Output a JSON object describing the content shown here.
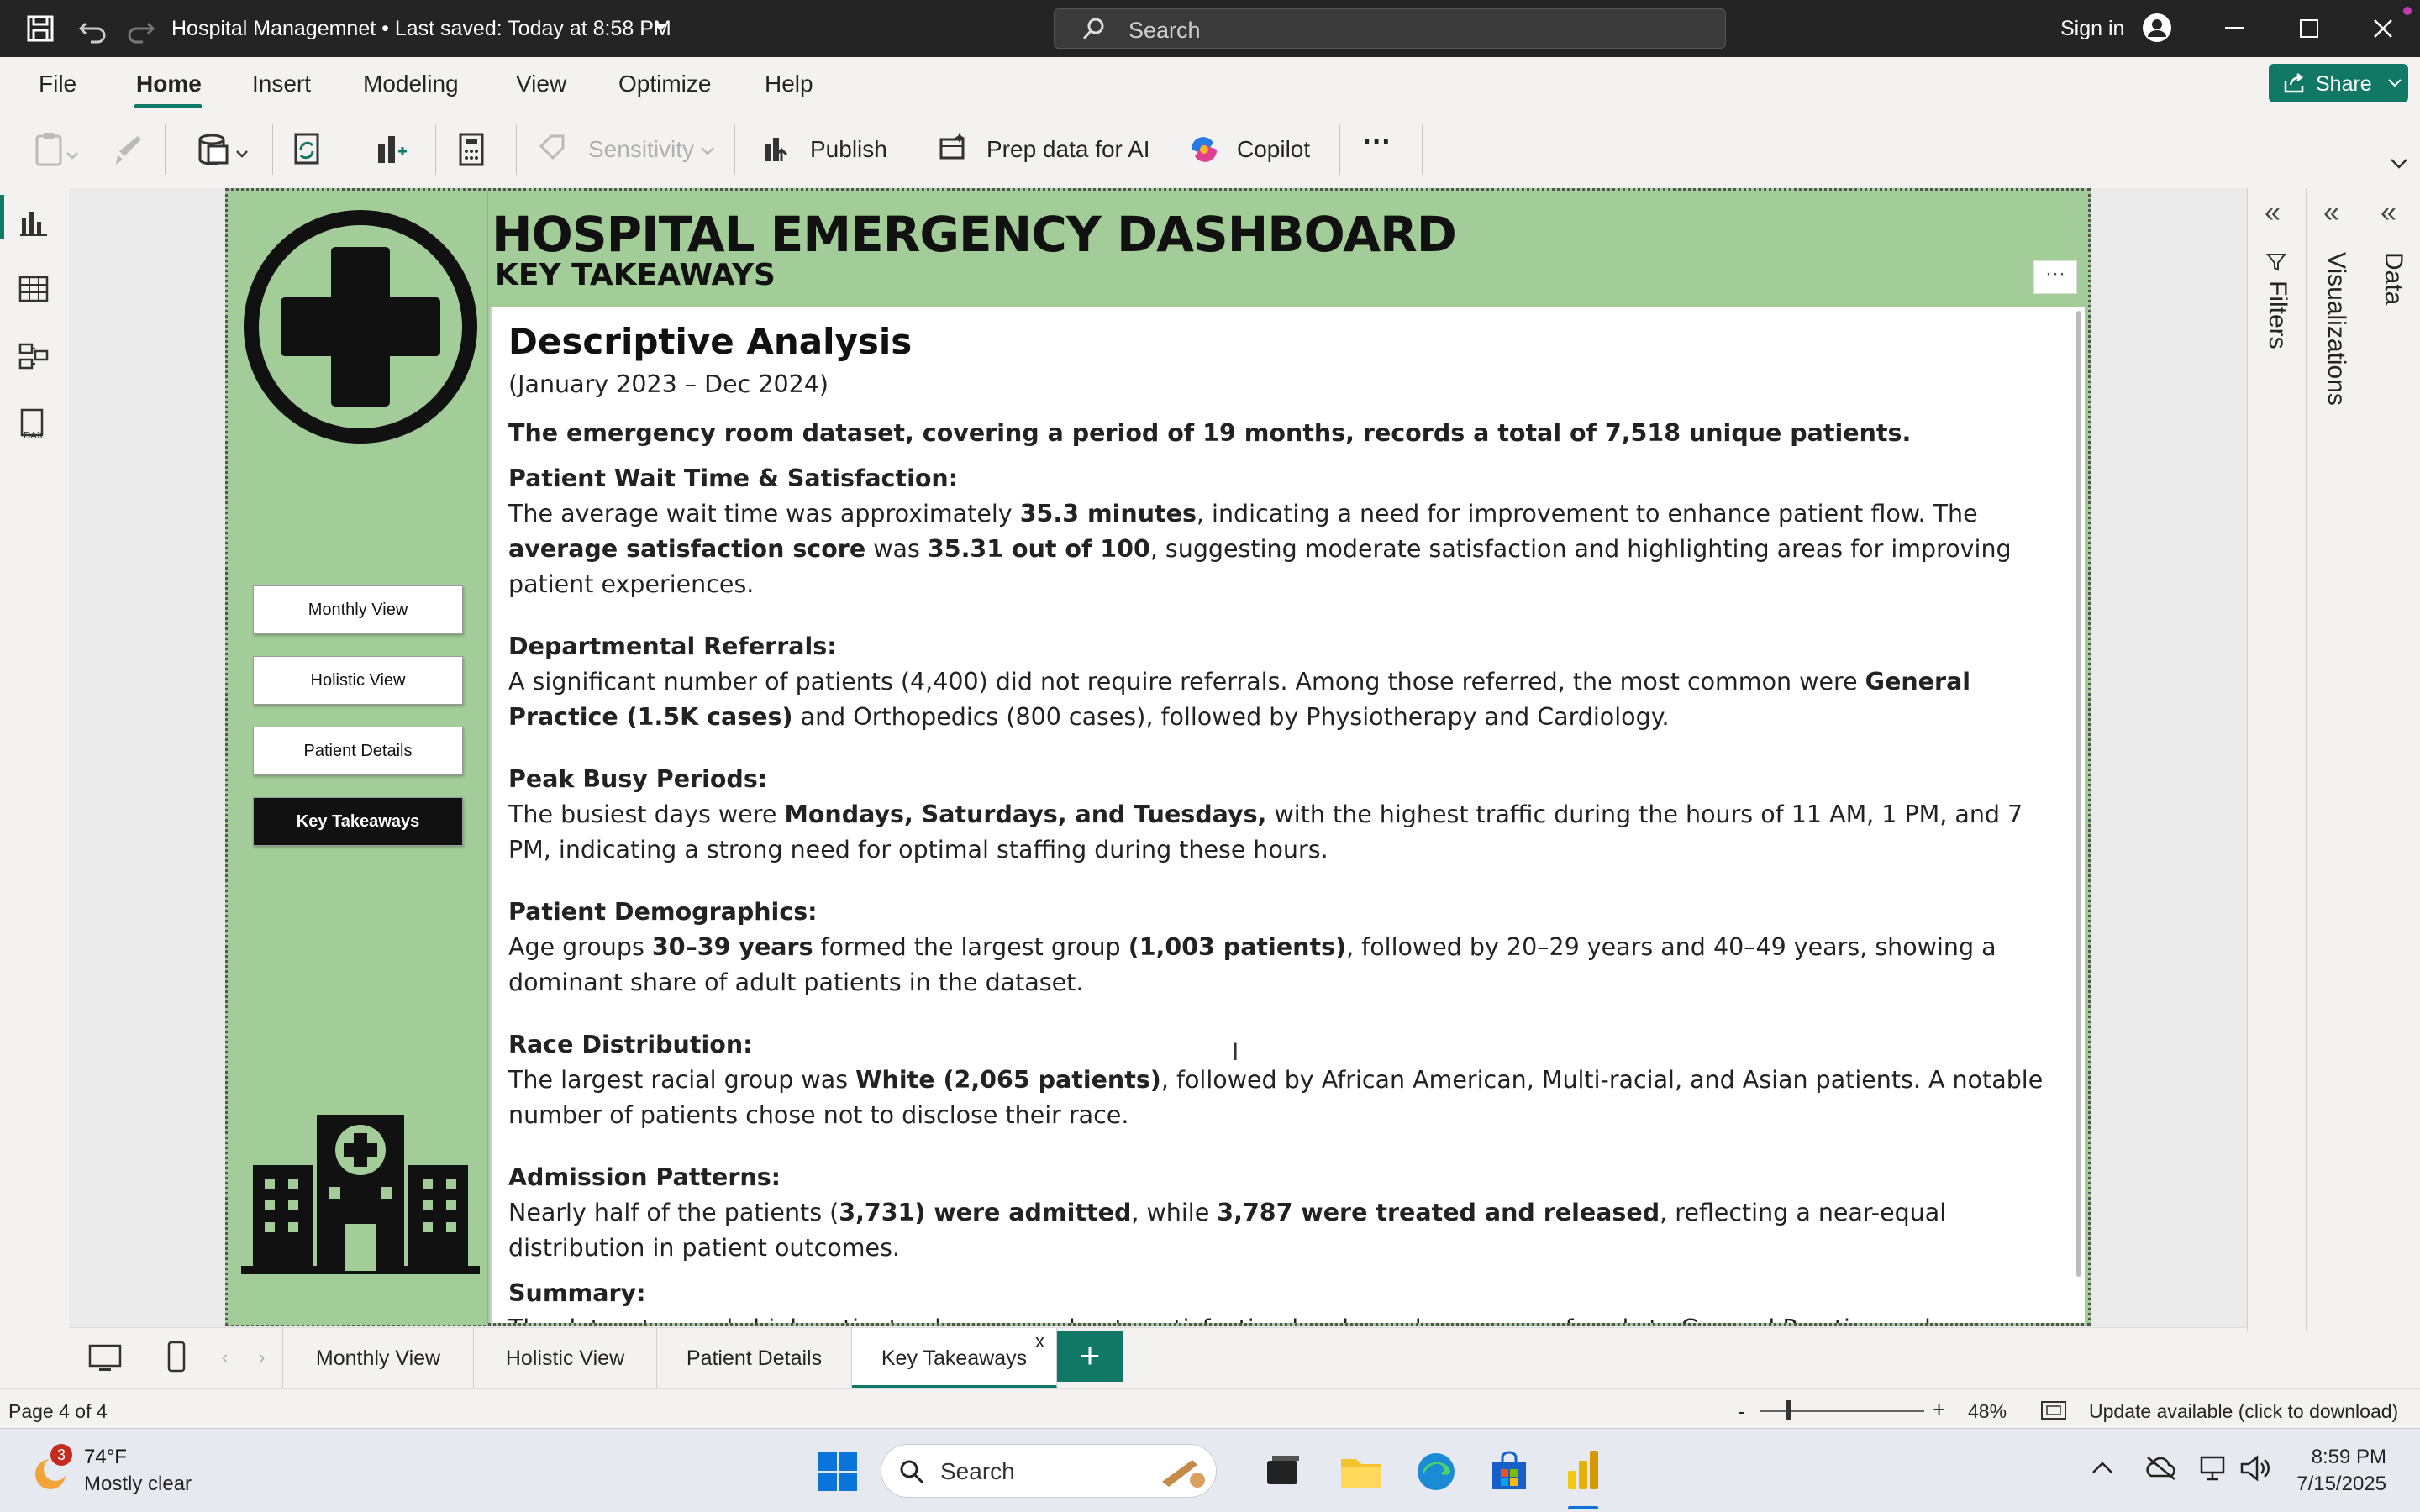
{
  "titlebar": {
    "doc_title": "Hospital Managemnet • Last saved: Today at 8:58 PM",
    "search_placeholder": "Search",
    "signin": "Sign in"
  },
  "menu": {
    "items": [
      "File",
      "Home",
      "Insert",
      "Modeling",
      "View",
      "Optimize",
      "Help"
    ],
    "share": "Share"
  },
  "ribbon": {
    "sensitivity": "Sensitivity",
    "publish": "Publish",
    "prep_data": "Prep data for AI",
    "copilot": "Copilot",
    "more": "···"
  },
  "report": {
    "title": "HOSPITAL EMERGENCY DASHBOARD",
    "subtitle": "KEY TAKEAWAYS",
    "nav": [
      "Monthly View",
      "Holistic View",
      "Patient Details",
      "Key Takeaways"
    ],
    "heading": "Descriptive Analysis",
    "dates": "(January 2023 – Dec 2024)",
    "lead": "The emergency room dataset, covering a period of 19 months, records a total of 7,518 unique patients.",
    "sections": {
      "wait": {
        "title": "Patient Wait Time & Satisfaction:",
        "t1": "The average wait time was approximately ",
        "b1": "35.3 minutes",
        "t2": ", indicating a need for improvement to enhance patient flow. The ",
        "b2": "average satisfaction score",
        "t3": " was ",
        "b3": "35.31 out of 100",
        "t4": ", suggesting moderate satisfaction and highlighting areas for improving patient experiences."
      },
      "referrals": {
        "title": "Departmental Referrals:",
        "t1": "A significant number of patients (4,400) did not require referrals. Among those referred, the most common were ",
        "b1": "General Practice (1.5K cases)",
        "t2": " and Orthopedics (800 cases), followed by Physiotherapy and Cardiology."
      },
      "busy": {
        "title": "Peak Busy Periods:",
        "t1": "The busiest days were ",
        "b1": "Mondays, Saturdays, and Tuesdays,",
        "t2": " with the highest traffic during the hours of 11 AM, 1 PM, and 7 PM, indicating a strong need for optimal staffing during these hours."
      },
      "demographics": {
        "title": "Patient Demographics:",
        "t1": "Age groups ",
        "b1": "30–39 years",
        "t2": " formed the largest group ",
        "b2": "(1,003 patients)",
        "t3": ", followed by 20–29 years and 40–49 years, showing a dominant share of adult patients in the dataset."
      },
      "race": {
        "title": "Race Distribution:",
        "t1": "The largest racial group was ",
        "b1": "White (2,065 patients)",
        "t2": ", followed by African American, Multi-racial, and Asian patients. A notable number of patients chose not to disclose their race."
      },
      "admission": {
        "title": "Admission Patterns:",
        "t1": "Nearly half of the patients (",
        "b1": "3,731) were admitted",
        "t2": ", while ",
        "b2": "3,787 were treated and released",
        "t3": ", reflecting a near-equal distribution in patient outcomes."
      },
      "summary": {
        "title": "Summary:",
        "t1": "The dataset reveals high patient volumes, moderate satisfaction levels, and common referrals to General Practice and Orthopedics. The analysis suggests targeted improvement areas in wait time management, staff allocation during peak hours, and patient service."
      }
    }
  },
  "panes": {
    "filters": "Filters",
    "visualizations": "Visualizations",
    "data": "Data"
  },
  "page_tabs": [
    "Monthly View",
    "Holistic View",
    "Patient Details",
    "Key Takeaways"
  ],
  "page_tab_close": "x",
  "status": {
    "page": "Page 4 of 4",
    "zoom": "48%",
    "zoom_level": 0.48,
    "update": "Update available (click to download)"
  },
  "taskbar": {
    "weather_badge": "3",
    "temp": "74°F",
    "weather": "Mostly clear",
    "search": "Search",
    "time": "8:59 PM",
    "date": "7/15/2025"
  },
  "colors": {
    "accent": "#117865",
    "report_bg": "#a3cd98",
    "titlebar": "#242424"
  }
}
